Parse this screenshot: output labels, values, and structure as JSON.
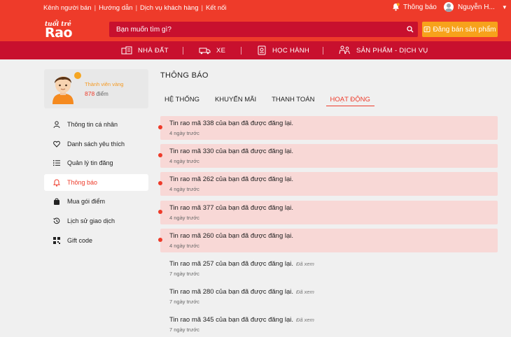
{
  "header": {
    "top_links": [
      "Kênh người bán",
      "Hướng dẫn",
      "Dịch vụ khách hàng",
      "Kết nối"
    ],
    "notifications_label": "Thông báo",
    "user_name": "Nguyễn H...",
    "logo_small": "tuổi trẻ",
    "logo_big": "Rao Vặt",
    "search_placeholder": "Bạn muốn tìm gì?",
    "post_button": "Đăng bán sản phẩm"
  },
  "nav": [
    "NHÀ ĐẤT",
    "XE",
    "HỌC HÀNH",
    "SẢN PHẨM - DỊCH VỤ"
  ],
  "profile": {
    "rank": "Thành viên vàng",
    "points_value": "878",
    "points_label": "điểm"
  },
  "sidebar": [
    {
      "label": "Thông tin cá nhân",
      "icon": "user-icon"
    },
    {
      "label": "Danh sách yêu thích",
      "icon": "heart-icon"
    },
    {
      "label": "Quản lý tin đăng",
      "icon": "list-icon"
    },
    {
      "label": "Thông báo",
      "icon": "bell-icon",
      "active": true
    },
    {
      "label": "Mua gói điểm",
      "icon": "bag-icon"
    },
    {
      "label": "Lịch sử giao dịch",
      "icon": "history-icon"
    },
    {
      "label": "Gift code",
      "icon": "qr-icon"
    }
  ],
  "main": {
    "title": "THÔNG BÁO",
    "tabs": [
      "HỆ THỐNG",
      "KHUYẾN MÃI",
      "THANH TOÁN",
      "HOẠT ĐỘNG"
    ],
    "active_tab": "HOẠT ĐỘNG"
  },
  "notifications": [
    {
      "message": "Tin rao mã 338 của bạn đã được đăng lại.",
      "time": "4 ngày trước",
      "unread": true,
      "seen_label": ""
    },
    {
      "message": "Tin rao mã 330 của bạn đã được đăng lại.",
      "time": "4 ngày trước",
      "unread": true,
      "seen_label": ""
    },
    {
      "message": "Tin rao mã 262 của bạn đã được đăng lại.",
      "time": "4 ngày trước",
      "unread": true,
      "seen_label": ""
    },
    {
      "message": "Tin rao mã 377 của bạn đã được đăng lại.",
      "time": "4 ngày trước",
      "unread": true,
      "seen_label": ""
    },
    {
      "message": "Tin rao mã 260 của bạn đã được đăng lại.",
      "time": "4 ngày trước",
      "unread": true,
      "seen_label": ""
    },
    {
      "message": "Tin rao mã 257 của bạn đã được đăng lại.",
      "time": "7 ngày trước",
      "unread": false,
      "seen_label": "Đã xem"
    },
    {
      "message": "Tin rao mã 280 của bạn đã được đăng lại.",
      "time": "7 ngày trước",
      "unread": false,
      "seen_label": "Đã xem"
    },
    {
      "message": "Tin rao mã 345 của bạn đã được đăng lại.",
      "time": "7 ngày trước",
      "unread": false,
      "seen_label": "Đã xem"
    }
  ],
  "colors": {
    "header_red": "#ee3b2a",
    "nav_red": "#c8102e",
    "orange": "#f7a21b",
    "unread_bg": "#f8d8d6"
  }
}
